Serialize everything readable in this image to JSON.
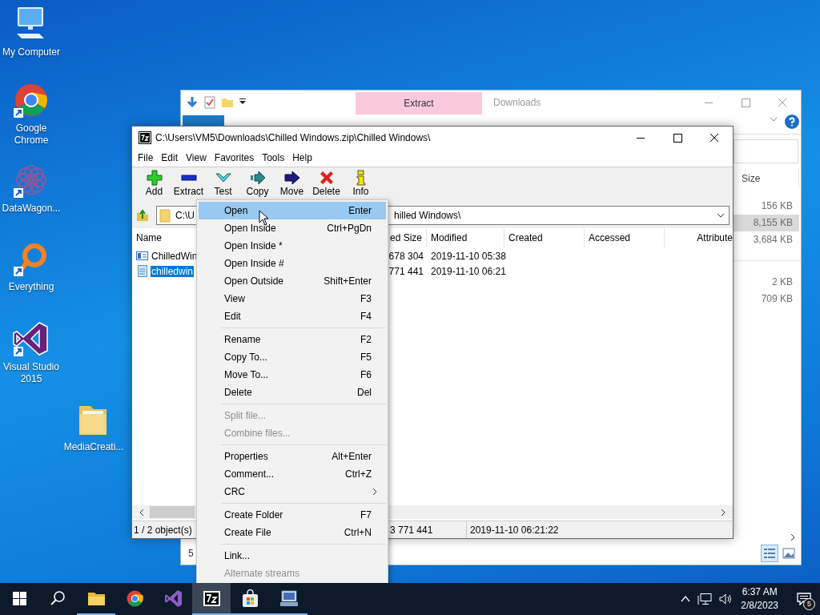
{
  "desktop_icons": [
    {
      "label": "My Computer",
      "kind": "computer",
      "shortcut": false
    },
    {
      "label": "Google Chrome",
      "kind": "chrome",
      "shortcut": true
    },
    {
      "label": "DataWagon...",
      "kind": "flower",
      "shortcut": true
    },
    {
      "label": "Everything",
      "kind": "magnifier",
      "shortcut": true
    },
    {
      "label": "Visual Studio 2015",
      "kind": "vs",
      "shortcut": true
    },
    {
      "label": "MediaCreati...",
      "kind": "folder",
      "shortcut": false
    }
  ],
  "explorer": {
    "title": "Downloads",
    "contextual_tab": "Extract",
    "size_header": "Size",
    "size_groups": [
      [
        {
          "text": "156 KB",
          "selected": false
        },
        {
          "text": "8,155 KB",
          "selected": true
        },
        {
          "text": "3,684 KB",
          "selected": false
        }
      ],
      [
        {
          "text": "2 KB",
          "selected": false
        },
        {
          "text": "709 KB",
          "selected": false
        }
      ]
    ],
    "status": "5",
    "views": [
      {
        "kind": "details",
        "selected": true
      },
      {
        "kind": "thumbnails",
        "selected": false
      }
    ]
  },
  "sevenzip": {
    "title": "C:\\Users\\VM5\\Downloads\\Chilled Windows.zip\\Chilled Windows\\",
    "menu": [
      "File",
      "Edit",
      "View",
      "Favorites",
      "Tools",
      "Help"
    ],
    "toolbar": [
      {
        "label": "Add",
        "kind": "add"
      },
      {
        "label": "Extract",
        "kind": "extract"
      },
      {
        "label": "Test",
        "kind": "test"
      },
      {
        "label": "Copy",
        "kind": "copy"
      },
      {
        "label": "Move",
        "kind": "move"
      },
      {
        "label": "Delete",
        "kind": "delete"
      },
      {
        "label": "Info",
        "kind": "info"
      }
    ],
    "address": "C:\\U",
    "address_tail": "hilled Windows\\",
    "columns": [
      "Name",
      "ed Size",
      "Modified",
      "Created",
      "Accessed",
      "Attribute"
    ],
    "rows": [
      {
        "kind": "document",
        "selected": false,
        "cells": [
          "ChilledWin",
          "678 304",
          "2019-11-10 05:38"
        ]
      },
      {
        "kind": "file",
        "selected": true,
        "cells": [
          "chilledwin",
          "771 441",
          "2019-11-10 06:21"
        ]
      }
    ],
    "status": [
      "1 / 2 object(s)",
      "3 771 441",
      "2019-11-10 06:21:22"
    ]
  },
  "context_menu": [
    [
      {
        "label": "Open",
        "shortcut": "Enter",
        "selected": true,
        "disabled": false,
        "submenu": false
      },
      {
        "label": "Open Inside",
        "shortcut": "Ctrl+PgDn",
        "selected": false,
        "disabled": false,
        "submenu": false
      },
      {
        "label": "Open Inside *",
        "selected": false,
        "disabled": false,
        "submenu": false
      },
      {
        "label": "Open Inside #",
        "selected": false,
        "disabled": false,
        "submenu": false
      },
      {
        "label": "Open Outside",
        "shortcut": "Shift+Enter",
        "selected": false,
        "disabled": false,
        "submenu": false
      },
      {
        "label": "View",
        "shortcut": "F3",
        "selected": false,
        "disabled": false,
        "submenu": false
      },
      {
        "label": "Edit",
        "shortcut": "F4",
        "selected": false,
        "disabled": false,
        "submenu": false
      }
    ],
    [
      {
        "label": "Rename",
        "shortcut": "F2",
        "selected": false,
        "disabled": false,
        "submenu": false
      },
      {
        "label": "Copy To...",
        "shortcut": "F5",
        "selected": false,
        "disabled": false,
        "submenu": false
      },
      {
        "label": "Move To...",
        "shortcut": "F6",
        "selected": false,
        "disabled": false,
        "submenu": false
      },
      {
        "label": "Delete",
        "shortcut": "Del",
        "selected": false,
        "disabled": false,
        "submenu": false
      }
    ],
    [
      {
        "label": "Split file...",
        "selected": false,
        "disabled": true,
        "submenu": false
      },
      {
        "label": "Combine files...",
        "selected": false,
        "disabled": true,
        "submenu": false
      }
    ],
    [
      {
        "label": "Properties",
        "shortcut": "Alt+Enter",
        "selected": false,
        "disabled": false,
        "submenu": false
      },
      {
        "label": "Comment...",
        "shortcut": "Ctrl+Z",
        "selected": false,
        "disabled": false,
        "submenu": false
      },
      {
        "label": "CRC",
        "selected": false,
        "disabled": false,
        "submenu": true
      }
    ],
    [
      {
        "label": "Create Folder",
        "shortcut": "F7",
        "selected": false,
        "disabled": false,
        "submenu": false
      },
      {
        "label": "Create File",
        "shortcut": "Ctrl+N",
        "selected": false,
        "disabled": false,
        "submenu": false
      }
    ],
    [
      {
        "label": "Link...",
        "selected": false,
        "disabled": false,
        "submenu": false
      },
      {
        "label": "Alternate streams",
        "selected": false,
        "disabled": true,
        "submenu": false
      }
    ]
  ],
  "taskbar": {
    "apps": [
      {
        "kind": "start",
        "active": false,
        "running": false
      },
      {
        "kind": "search",
        "active": false,
        "running": false
      },
      {
        "kind": "folder",
        "active": false,
        "running": true
      },
      {
        "kind": "chrome",
        "active": false,
        "running": false
      },
      {
        "kind": "vs",
        "active": false,
        "running": false
      },
      {
        "kind": "sevenzip",
        "active": true,
        "running": true
      },
      {
        "kind": "store",
        "active": false,
        "running": true
      },
      {
        "kind": "remote",
        "active": false,
        "running": true
      }
    ],
    "time": "6:37 AM",
    "date": "2/8/2023",
    "notifications": "5"
  }
}
